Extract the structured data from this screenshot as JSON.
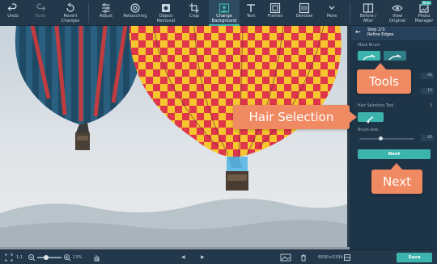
{
  "toolbar": {
    "items": [
      {
        "label": "Undo",
        "icon": "undo-icon"
      },
      {
        "label": "Redo",
        "icon": "redo-icon"
      },
      {
        "label": "Revert Changes",
        "icon": "revert-icon"
      },
      {
        "label": "Adjust",
        "icon": "sliders-icon"
      },
      {
        "label": "Retouching",
        "icon": "retouch-icon"
      },
      {
        "label": "Object Removal",
        "icon": "object-removal-icon"
      },
      {
        "label": "Crop",
        "icon": "crop-icon"
      },
      {
        "label": "Change Background",
        "icon": "change-background-icon"
      },
      {
        "label": "Text",
        "icon": "text-icon"
      },
      {
        "label": "Frames",
        "icon": "frames-icon"
      },
      {
        "label": "Denoise",
        "icon": "denoise-icon"
      },
      {
        "label": "More",
        "icon": "chevron-down-icon"
      },
      {
        "label": "Before / After",
        "icon": "before-after-icon"
      },
      {
        "label": "View Original",
        "icon": "eye-icon"
      },
      {
        "label": "Photo Manager",
        "icon": "photo-manager-icon"
      }
    ],
    "badge": "New",
    "active": "Change Background"
  },
  "panel": {
    "step": "Step 2/3:",
    "title": "Refine Edges",
    "mask_brush_label": "Mask Brush",
    "field1": "40",
    "field2": "15",
    "hair_tool_label": "Hair Selection Tool",
    "help": "?",
    "brush_size_label": "Brush size:",
    "brush_size_value": "45",
    "next_label": "Next"
  },
  "callouts": {
    "tools": "Tools",
    "hair": "Hair Selection",
    "next": "Next"
  },
  "bottom": {
    "ratio": "1:1",
    "zoom": "13%",
    "dimensions": "6000×5334",
    "save_label": "Save"
  },
  "colors": {
    "accent": "#3cb4ad",
    "callout": "#f08a63",
    "panel_bg": "#1e3447",
    "toolbar_bg": "#23384a"
  }
}
